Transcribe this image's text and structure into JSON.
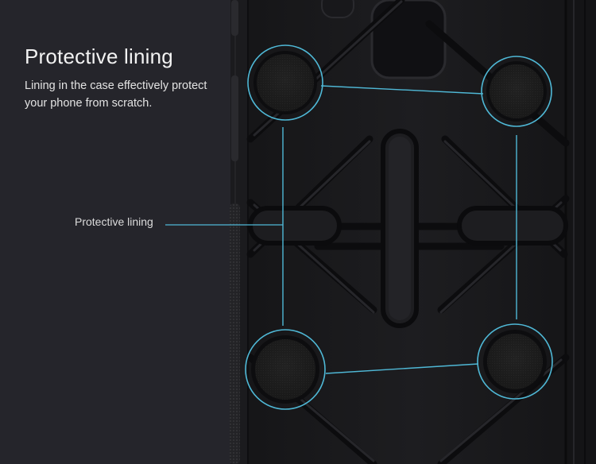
{
  "heading": "Protective lining",
  "description": "Lining in the case effectively protect your phone from scratch.",
  "callout_label": "Protective lining",
  "colors": {
    "background": "#25252b",
    "case": "#1a1a1d",
    "highlight": "#4fb8d6",
    "text": "#f2f2f2"
  }
}
